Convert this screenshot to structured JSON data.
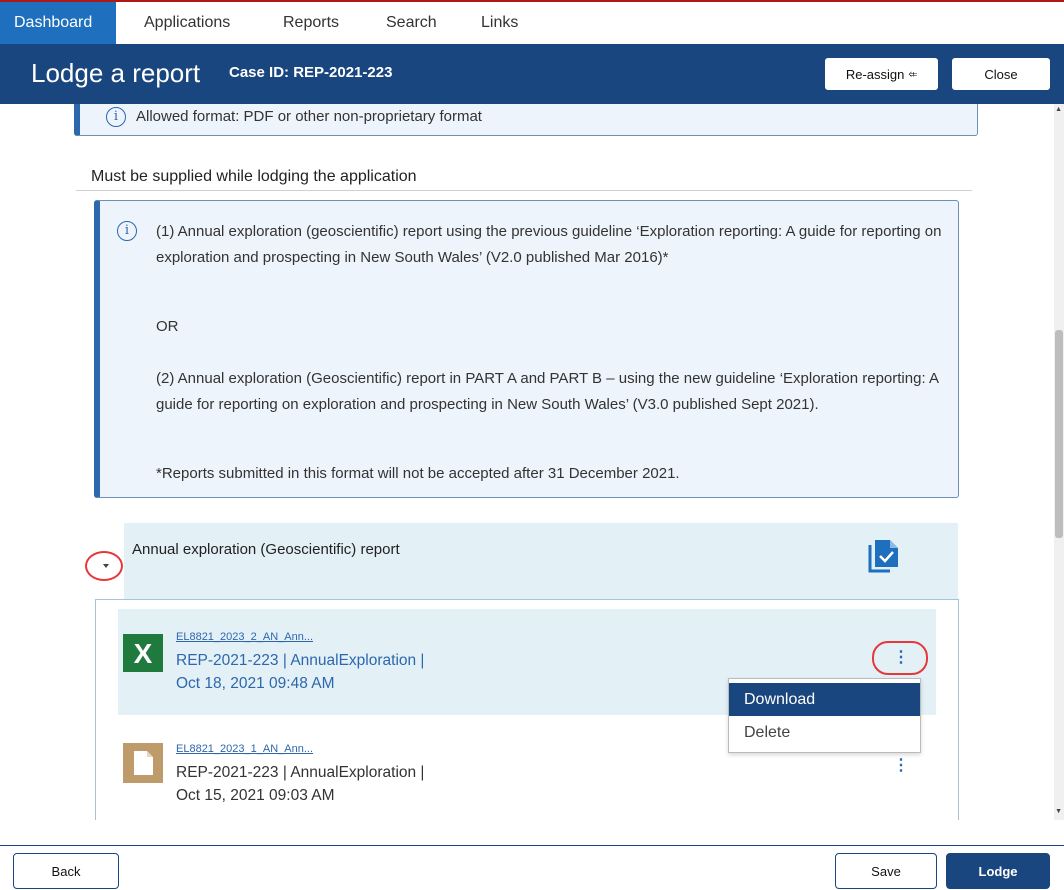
{
  "nav": {
    "tabs": [
      {
        "label": "Dashboard"
      },
      {
        "label": "Applications"
      },
      {
        "label": "Reports"
      },
      {
        "label": "Search"
      },
      {
        "label": "Links"
      }
    ]
  },
  "header": {
    "title": "Lodge a report",
    "case_id": "Case ID: REP-2021-223",
    "reassign_label": "Re-assign",
    "close_label": "Close"
  },
  "info_format": {
    "text": "Allowed format: PDF or other non-proprietary format"
  },
  "section": {
    "heading": "Must be supplied while lodging the application"
  },
  "guideline_info": {
    "p1": "(1) Annual exploration (geoscientific) report using the previous guideline ‘Exploration reporting: A guide for reporting on exploration and prospecting in New South Wales’ (V2.0 published Mar 2016)*",
    "or": "OR",
    "p2": "(2) Annual exploration (Geoscientific) report in PART A and PART B – using the new guideline ‘Exploration reporting: A guide for reporting on exploration and prospecting in New South Wales’ (V3.0 published Sept 2021).",
    "note": "*Reports submitted in this format will not be accepted after 31 December 2021."
  },
  "accordion": {
    "title": "Annual exploration (Geoscientific) report"
  },
  "files": [
    {
      "name": "EL8821_2023_2_AN_Ann...",
      "line1": "REP-2021-223 | AnnualExploration |",
      "line2": "Oct 18, 2021 09:48 AM",
      "icon": "excel-icon"
    },
    {
      "name": "EL8821_2023_1_AN_Ann...",
      "line1": "REP-2021-223 | AnnualExploration |",
      "line2": "Oct 15, 2021 09:03 AM",
      "icon": "document-icon"
    }
  ],
  "context_menu": {
    "download": "Download",
    "delete": "Delete"
  },
  "footer": {
    "back_label": "Back",
    "save_label": "Save",
    "lodge_label": "Lodge"
  },
  "colors": {
    "header_bg": "#19467e",
    "nav_active": "#1e6fbd",
    "info_bg": "#eef4fb",
    "accordion_bg": "#e3f0f6",
    "highlight_ring": "#e5383b"
  }
}
